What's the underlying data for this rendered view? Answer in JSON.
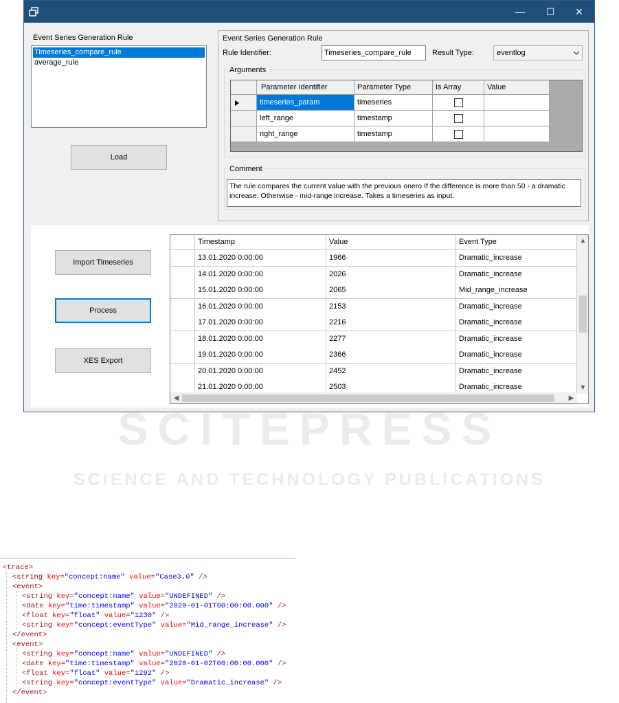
{
  "window": {
    "controls": {
      "minimize": "—",
      "maximize": "☐",
      "close": "✕"
    }
  },
  "left_panel": {
    "title": "Event Series Generation Rule",
    "rules": [
      "Timeseries_compare_rule",
      "average_rule"
    ],
    "selected_index": 0,
    "load_button": "Load"
  },
  "rule_group": {
    "title": "Event Series Generation Rule",
    "rule_identifier_label": "Rule Identifier:",
    "rule_identifier_value": "Timeseries_compare_rule",
    "result_type_label": "Result Type:",
    "result_type_value": "eventlog",
    "arguments": {
      "title": "Arguments",
      "columns": [
        "Parameter Identifier",
        "Parameter Type",
        "Is Array",
        "Value"
      ],
      "rows": [
        {
          "identifier": "timeseries_param",
          "type": "timeseries",
          "is_array": false,
          "value": ""
        },
        {
          "identifier": "left_range",
          "type": "timestamp",
          "is_array": false,
          "value": ""
        },
        {
          "identifier": "right_range",
          "type": "timestamp",
          "is_array": false,
          "value": ""
        }
      ],
      "selected_row": 0
    },
    "comment": {
      "title": "Comment",
      "text": "The rule compares the current value with the previous onero If the difference is more than 50 - a dramatic increase. Otherwise - mid-range increase. Takes a timeseries as input."
    }
  },
  "actions": {
    "import": "Import Timeseries",
    "process": "Process",
    "xes_export": "XES Export"
  },
  "timeseries_table": {
    "columns": [
      "Timestamp",
      "Value",
      "Event Type"
    ],
    "rows": [
      [
        "13.01.2020 0:00:00",
        "1966",
        "Dramatic_increase"
      ],
      [
        "14.01.2020 0:00:00",
        "2026",
        "Dramatic_increase"
      ],
      [
        "15.01.2020 0:00:00",
        "2065",
        "Mid_range_increase"
      ],
      [
        "16.01.2020 0:00:00",
        "2153",
        "Dramatic_increase"
      ],
      [
        "17.01.2020 0:00:00",
        "2216",
        "Dramatic_increase"
      ],
      [
        "18.01.2020 0:00:00",
        "2277",
        "Dramatic_increase"
      ],
      [
        "19.01.2020 0:00:00",
        "2366",
        "Dramatic_increase"
      ],
      [
        "20.01.2020 0:00:00",
        "2452",
        "Dramatic_increase"
      ],
      [
        "21.01.2020 0:00:00",
        "2503",
        "Dramatic_increase"
      ]
    ]
  },
  "watermark": {
    "main": "SCITEPRESS",
    "sub": "SCIENCE AND TECHNOLOGY PUBLICATIONS"
  },
  "xml_lines": [
    {
      "indent": 0,
      "parts": [
        [
          "t",
          "<trace>"
        ]
      ]
    },
    {
      "indent": 1,
      "parts": [
        [
          "t",
          "<string "
        ],
        [
          "a",
          "key"
        ],
        [
          "t",
          "="
        ],
        [
          "v",
          "\"concept:name\""
        ],
        [
          "a",
          " value"
        ],
        [
          "t",
          "="
        ],
        [
          "v",
          "\"Case3.0\""
        ],
        [
          "t",
          " />"
        ]
      ]
    },
    {
      "indent": 1,
      "parts": [
        [
          "t",
          "<event>"
        ]
      ]
    },
    {
      "indent": 2,
      "parts": [
        [
          "t",
          "<string "
        ],
        [
          "a",
          "key"
        ],
        [
          "t",
          "="
        ],
        [
          "v",
          "\"concept:name\""
        ],
        [
          "a",
          " value"
        ],
        [
          "t",
          "="
        ],
        [
          "v",
          "\"UNDEFINED\""
        ],
        [
          "t",
          " />"
        ]
      ]
    },
    {
      "indent": 2,
      "parts": [
        [
          "t",
          "<date "
        ],
        [
          "a",
          "key"
        ],
        [
          "t",
          "="
        ],
        [
          "v",
          "\"time:timestamp\""
        ],
        [
          "a",
          " value"
        ],
        [
          "t",
          "="
        ],
        [
          "v",
          "\"2020-01-01T00:00:00.000\""
        ],
        [
          "t",
          " />"
        ]
      ]
    },
    {
      "indent": 2,
      "parts": [
        [
          "t",
          "<float "
        ],
        [
          "a",
          "key"
        ],
        [
          "t",
          "="
        ],
        [
          "v",
          "\"float\""
        ],
        [
          "a",
          " value"
        ],
        [
          "t",
          "="
        ],
        [
          "v",
          "\"1230\""
        ],
        [
          "t",
          " />"
        ]
      ]
    },
    {
      "indent": 2,
      "parts": [
        [
          "t",
          "<string "
        ],
        [
          "a",
          "key"
        ],
        [
          "t",
          "="
        ],
        [
          "v",
          "\"concept:eventType\""
        ],
        [
          "a",
          " value"
        ],
        [
          "t",
          "="
        ],
        [
          "v",
          "\"Mid_range_increase\""
        ],
        [
          "t",
          " />"
        ]
      ]
    },
    {
      "indent": 1,
      "parts": [
        [
          "t",
          "</event>"
        ]
      ]
    },
    {
      "indent": 1,
      "parts": [
        [
          "t",
          "<event>"
        ]
      ]
    },
    {
      "indent": 2,
      "parts": [
        [
          "t",
          "<string "
        ],
        [
          "a",
          "key"
        ],
        [
          "t",
          "="
        ],
        [
          "v",
          "\"concept:name\""
        ],
        [
          "a",
          " value"
        ],
        [
          "t",
          "="
        ],
        [
          "v",
          "\"UNDEFINED\""
        ],
        [
          "t",
          " />"
        ]
      ]
    },
    {
      "indent": 2,
      "parts": [
        [
          "t",
          "<date "
        ],
        [
          "a",
          "key"
        ],
        [
          "t",
          "="
        ],
        [
          "v",
          "\"time:timestamp\""
        ],
        [
          "a",
          " value"
        ],
        [
          "t",
          "="
        ],
        [
          "v",
          "\"2020-01-02T00:00:00.000\""
        ],
        [
          "t",
          " />"
        ]
      ]
    },
    {
      "indent": 2,
      "parts": [
        [
          "t",
          "<float "
        ],
        [
          "a",
          "key"
        ],
        [
          "t",
          "="
        ],
        [
          "v",
          "\"float\""
        ],
        [
          "a",
          " value"
        ],
        [
          "t",
          "="
        ],
        [
          "v",
          "\"1292\""
        ],
        [
          "t",
          " />"
        ]
      ]
    },
    {
      "indent": 2,
      "parts": [
        [
          "t",
          "<string "
        ],
        [
          "a",
          "key"
        ],
        [
          "t",
          "="
        ],
        [
          "v",
          "\"concept:eventType\""
        ],
        [
          "a",
          " value"
        ],
        [
          "t",
          "="
        ],
        [
          "v",
          "\"Dramatic_increase\""
        ],
        [
          "t",
          " />"
        ]
      ]
    },
    {
      "indent": 1,
      "parts": [
        [
          "t",
          "</event>"
        ]
      ]
    }
  ],
  "colors": {
    "titlebar": "#1f4e79",
    "selection": "#0078d7",
    "xml_tag": "#a31515",
    "xml_attr": "#ff0000",
    "xml_value": "#0000ff"
  }
}
